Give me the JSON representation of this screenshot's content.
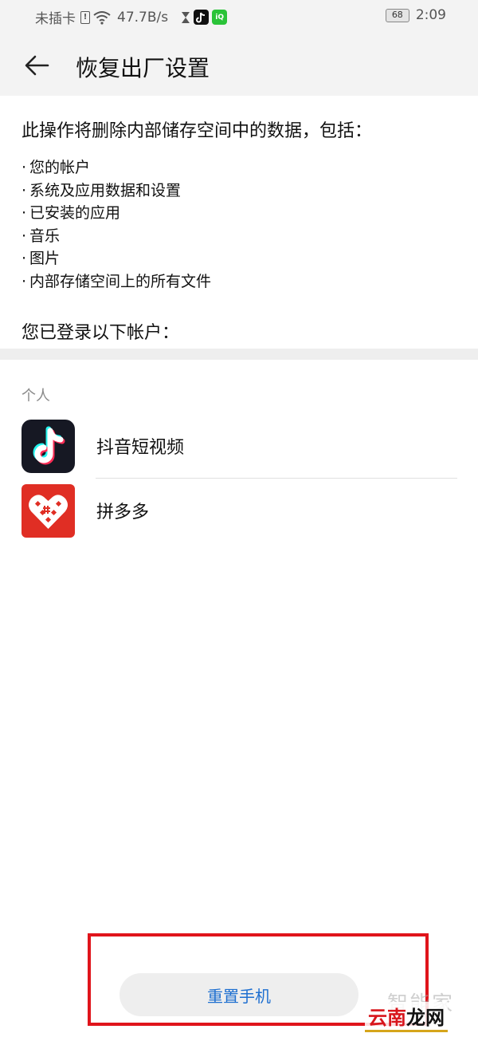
{
  "status_bar": {
    "carrier": "未插卡",
    "speed": "47.7B/s",
    "battery": "68",
    "time": "2:09"
  },
  "header": {
    "title": "恢复出厂设置"
  },
  "content": {
    "intro": "此操作将删除内部储存空间中的数据，包括：",
    "bullets": [
      "您的帐户",
      "系统及应用数据和设置",
      "已安装的应用",
      "音乐",
      "图片",
      "内部存储空间上的所有文件"
    ],
    "accounts_heading": "您已登录以下帐户："
  },
  "accounts": {
    "section_label": "个人",
    "items": [
      {
        "name": "抖音短视频",
        "icon": "douyin-icon"
      },
      {
        "name": "拼多多",
        "icon": "pinduoduo-icon"
      }
    ]
  },
  "actions": {
    "reset_label": "重置手机",
    "highlight_color": "#e0141b"
  },
  "watermark": {
    "line1": "智能家",
    "line2_a": "云南",
    "line2_b": "龙网"
  }
}
